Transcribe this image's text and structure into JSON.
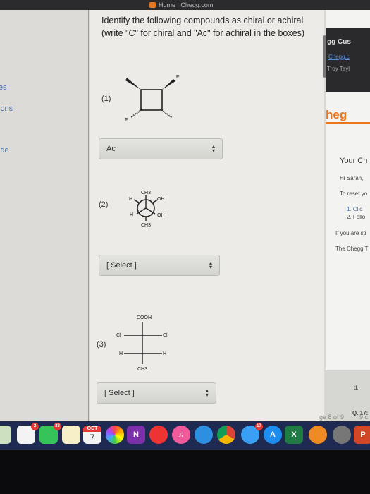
{
  "window": {
    "title": "Home | Chegg.com"
  },
  "sidebar": {
    "items": [
      {
        "label": "es"
      },
      {
        "label": "ions"
      },
      {
        "label": "ide"
      }
    ]
  },
  "question": {
    "text": "Identify the following compounds as chiral or achiral (write \"C\" for chiral and \"Ac\" for achiral in the boxes)",
    "items": [
      {
        "number": "(1)",
        "atoms": [
          "F",
          "F"
        ],
        "selected": "Ac"
      },
      {
        "number": "(2)",
        "atoms": [
          "CH3",
          "H",
          "OH",
          "H",
          "OH",
          "CH3"
        ],
        "selected": "[ Select ]"
      },
      {
        "number": "(3)",
        "atoms": [
          "COOH",
          "Cl",
          "Cl",
          "H",
          "H",
          "CH3"
        ],
        "selected": "[ Select ]"
      }
    ]
  },
  "right_panel": {
    "header": [
      "gg Cus",
      "Chegg.c",
      "Troy Tayl"
    ],
    "logo": "heg",
    "title": "Your Ch",
    "greeting": "Hi Sarah,",
    "line1": "To reset yo",
    "steps": [
      "1. Clic",
      "2. Follo"
    ],
    "line2": "If you are sti",
    "line3": "The Chegg T",
    "footer": [
      "d.",
      "Q. 17:",
      "ge 8 of 9",
      "9 c"
    ]
  },
  "dock": {
    "items": [
      {
        "name": "reminders",
        "badge": "2"
      },
      {
        "name": "facetime",
        "badge": "33"
      },
      {
        "name": "notes"
      },
      {
        "name": "calendar",
        "label": "7",
        "month": "OCT"
      },
      {
        "name": "photos"
      },
      {
        "name": "onenote",
        "label": "N"
      },
      {
        "name": "news"
      },
      {
        "name": "music"
      },
      {
        "name": "safari"
      },
      {
        "name": "chrome"
      },
      {
        "name": "messages",
        "badge": "17"
      },
      {
        "name": "app-store"
      },
      {
        "name": "excel",
        "label": "X"
      },
      {
        "name": "books"
      },
      {
        "name": "launchpad"
      },
      {
        "name": "powerpoint",
        "label": "P"
      }
    ]
  },
  "colors": {
    "accent_orange": "#e87722",
    "link": "#3d6fb0",
    "dock": "#1e2a52"
  }
}
